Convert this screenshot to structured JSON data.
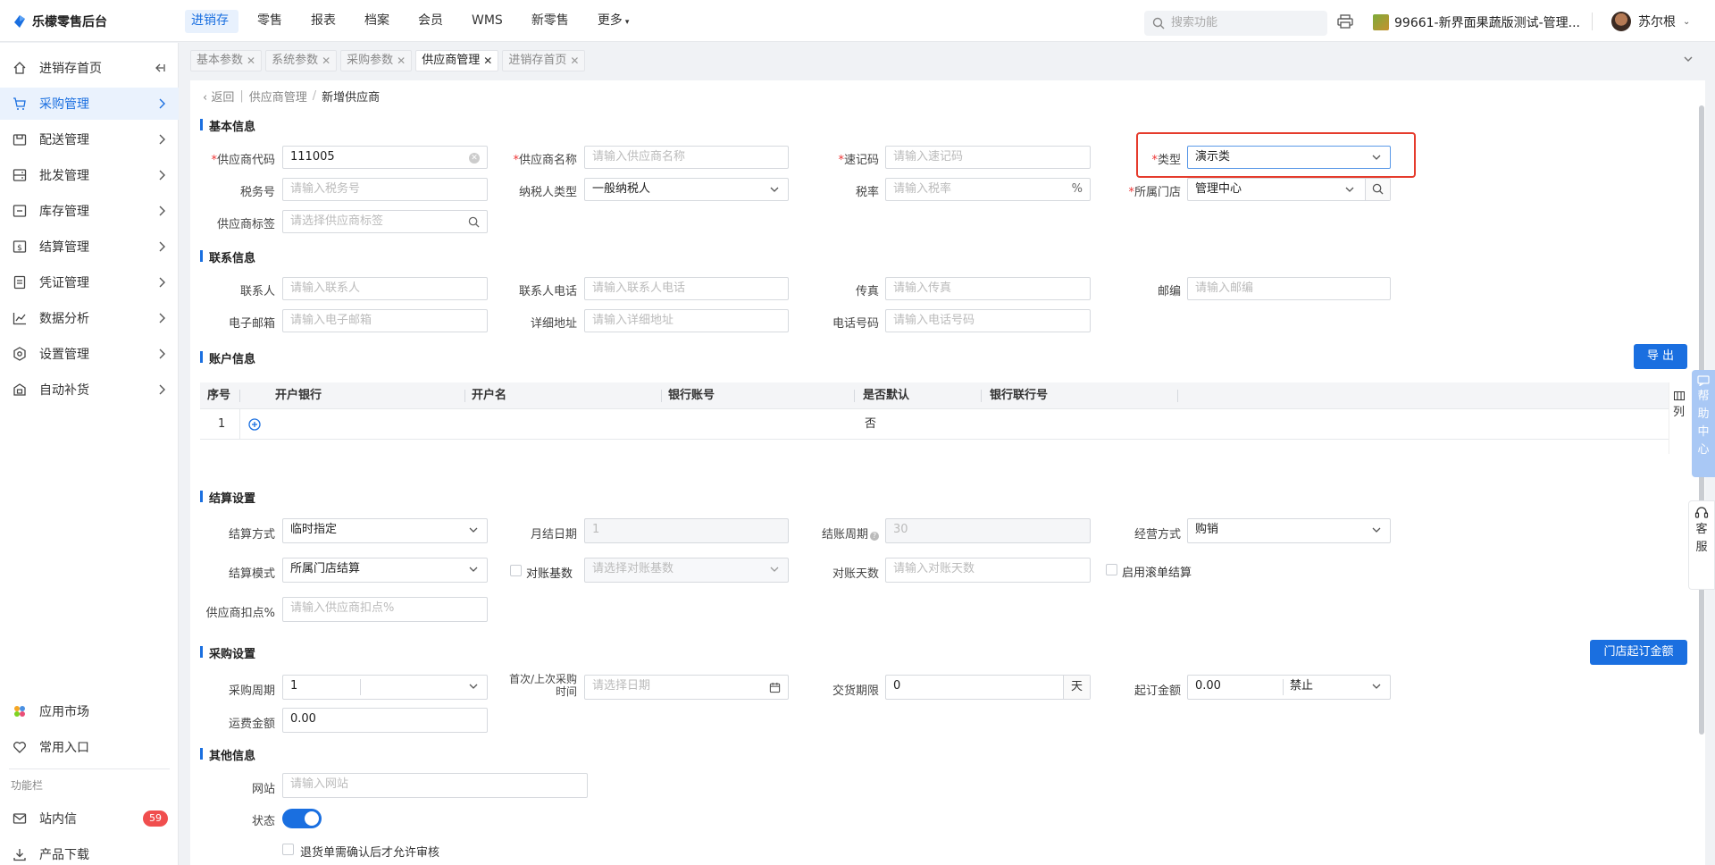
{
  "app": {
    "name": "乐檬零售后台"
  },
  "topnav": [
    "进销存",
    "零售",
    "报表",
    "档案",
    "会员",
    "WMS",
    "新零售",
    "更多"
  ],
  "search": {
    "placeholder": "搜索功能"
  },
  "store": {
    "name": "99661-新界面果蔬版测试-管理..."
  },
  "user": {
    "name": "苏尔根"
  },
  "sidebar": {
    "items": [
      {
        "label": "进销存首页"
      },
      {
        "label": "采购管理"
      },
      {
        "label": "配送管理"
      },
      {
        "label": "批发管理"
      },
      {
        "label": "库存管理"
      },
      {
        "label": "结算管理"
      },
      {
        "label": "凭证管理"
      },
      {
        "label": "数据分析"
      },
      {
        "label": "设置管理"
      },
      {
        "label": "自动补货"
      }
    ],
    "bottom": [
      {
        "label": "应用市场"
      },
      {
        "label": "常用入口"
      }
    ],
    "section_label": "功能栏",
    "messages": {
      "label": "站内信",
      "count": "59"
    },
    "download": {
      "label": "产品下载"
    }
  },
  "tabs": [
    "基本参数",
    "系统参数",
    "采购参数",
    "供应商管理",
    "进销存首页"
  ],
  "breadcrumb": {
    "back": "返回",
    "parent": "供应商管理",
    "current": "新增供应商"
  },
  "basic": {
    "title": "基本信息",
    "supplier_code": {
      "label": "供应商代码",
      "value": "111005"
    },
    "supplier_name": {
      "label": "供应商名称",
      "placeholder": "请输入供应商名称"
    },
    "quick_code": {
      "label": "速记码",
      "placeholder": "请输入速记码"
    },
    "type": {
      "label": "类型",
      "value": "演示类"
    },
    "tax_no": {
      "label": "税务号",
      "placeholder": "请输入税务号"
    },
    "taxpayer_type": {
      "label": "纳税人类型",
      "value": "一般纳税人"
    },
    "tax_rate": {
      "label": "税率",
      "placeholder": "请输入税率",
      "suffix": "%"
    },
    "store": {
      "label": "所属门店",
      "value": "管理中心"
    },
    "tag": {
      "label": "供应商标签",
      "placeholder": "请选择供应商标签"
    }
  },
  "contact": {
    "title": "联系信息",
    "person": {
      "label": "联系人",
      "placeholder": "请输入联系人"
    },
    "phone": {
      "label": "联系人电话",
      "placeholder": "请输入联系人电话"
    },
    "fax": {
      "label": "传真",
      "placeholder": "请输入传真"
    },
    "zip": {
      "label": "邮编",
      "placeholder": "请输入邮编"
    },
    "email": {
      "label": "电子邮箱",
      "placeholder": "请输入电子邮箱"
    },
    "address": {
      "label": "详细地址",
      "placeholder": "请输入详细地址"
    },
    "tel": {
      "label": "电话号码",
      "placeholder": "请输入电话号码"
    }
  },
  "account": {
    "title": "账户信息",
    "export_label": "导 出",
    "columns": [
      "序号",
      "开户银行",
      "开户名",
      "银行账号",
      "是否默认",
      "银行联行号"
    ],
    "rows": [
      {
        "index": "1",
        "default": "否"
      }
    ],
    "col_btn": "列"
  },
  "settlement": {
    "title": "结算设置",
    "method": {
      "label": "结算方式",
      "value": "临时指定"
    },
    "month_day": {
      "label": "月结日期",
      "value": "1"
    },
    "cycle": {
      "label": "结账周期",
      "value": "30"
    },
    "biz_mode": {
      "label": "经营方式",
      "value": "购销"
    },
    "mode": {
      "label": "结算模式",
      "value": "所属门店结算"
    },
    "base_check": {
      "label": "对账基数",
      "placeholder": "请选择对账基数"
    },
    "days": {
      "label": "对账天数",
      "placeholder": "请输入对账天数"
    },
    "rolling": {
      "label": "启用滚单结算"
    },
    "discount": {
      "label": "供应商扣点%",
      "placeholder": "请输入供应商扣点%"
    }
  },
  "purchase": {
    "title": "采购设置",
    "min_order_btn": "门店起订金额",
    "period": {
      "label": "采购周期",
      "value": "1"
    },
    "date": {
      "label": "首次/上次采购时间",
      "placeholder": "请选择日期"
    },
    "delivery": {
      "label": "交货期限",
      "value": "0",
      "unit": "天"
    },
    "min_amount": {
      "label": "起订金额",
      "value": "0.00",
      "mode": "禁止"
    },
    "freight": {
      "label": "运费金额",
      "value": "0.00"
    }
  },
  "other": {
    "title": "其他信息",
    "website": {
      "label": "网站",
      "placeholder": "请输入网站"
    },
    "status": {
      "label": "状态",
      "on": true
    },
    "return_confirm": {
      "label": "退货单需确认后才允许审核"
    }
  },
  "float": {
    "help": "帮助中心",
    "service": "客服"
  },
  "colors": {
    "accent": "#1a6fe0",
    "highlight": "#e53b2c",
    "badge": "#f04e4e"
  }
}
